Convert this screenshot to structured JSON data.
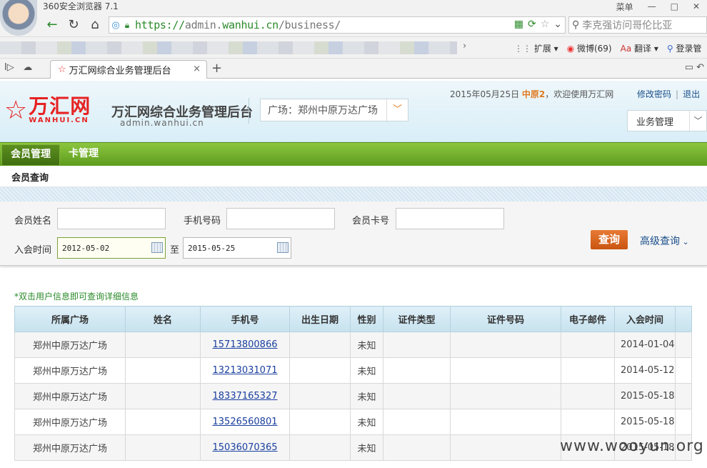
{
  "browser": {
    "name": "360安全浏览器 7.1",
    "window_controls": [
      "菜单",
      "—",
      "□",
      "✕"
    ],
    "url_scheme": "https://",
    "url_host_prefix": "admin.",
    "url_host_main": "wanhui.cn",
    "url_path": "/business/",
    "search_text": "李克强访问哥伦比亚",
    "favbar": {
      "extensions": "扩展",
      "weibo": "微博(69)",
      "translate": "翻译",
      "login": "登录管"
    },
    "tab_title": "万汇网综合业务管理后台"
  },
  "header": {
    "logo_cn": "万汇网",
    "logo_en": "WANHUI.CN",
    "title": "万汇网综合业务管理后台",
    "domain": "admin.wanhui.cn",
    "plaza_label": "广场：郑州中原万达广场",
    "date": "2015年05月25日",
    "username": "中原2",
    "welcome": "，欢迎使用万汇网",
    "change_password": "修改密码",
    "logout": "退出",
    "module_select": "业务管理"
  },
  "nav": {
    "items": [
      "会员管理",
      "卡管理"
    ],
    "sub_title": "会员查询"
  },
  "search": {
    "member_name_label": "会员姓名",
    "phone_label": "手机号码",
    "card_label": "会员卡号",
    "join_time_label": "入会时间",
    "date_from": "2012-05-02",
    "date_sep": "至",
    "date_to": "2015-05-25",
    "query_button": "查询",
    "advanced_query": "高级查询"
  },
  "results": {
    "hint": "*双击用户信息即可查询详细信息",
    "columns": [
      "所属广场",
      "姓名",
      "手机号",
      "出生日期",
      "性别",
      "证件类型",
      "证件号码",
      "电子邮件",
      "入会时间"
    ],
    "rows": [
      {
        "plaza": "郑州中原万达广场",
        "name": "",
        "phone": "15713800866",
        "birth": "",
        "gender": "未知",
        "id_type": "",
        "id_no": "",
        "email": "",
        "join": "2014-01-04"
      },
      {
        "plaza": "郑州中原万达广场",
        "name": "",
        "phone": "13213031071",
        "birth": "",
        "gender": "未知",
        "id_type": "",
        "id_no": "",
        "email": "",
        "join": "2014-05-12"
      },
      {
        "plaza": "郑州中原万达广场",
        "name": "",
        "phone": "18337165327",
        "birth": "",
        "gender": "未知",
        "id_type": "",
        "id_no": "",
        "email": "",
        "join": "2015-05-18"
      },
      {
        "plaza": "郑州中原万达广场",
        "name": "",
        "phone": "13526560801",
        "birth": "",
        "gender": "未知",
        "id_type": "",
        "id_no": "",
        "email": "",
        "join": "2015-05-18"
      },
      {
        "plaza": "郑州中原万达广场",
        "name": "",
        "phone": "15036070365",
        "birth": "",
        "gender": "未知",
        "id_type": "",
        "id_no": "",
        "email": "",
        "join": "2015-05-18"
      }
    ]
  },
  "watermark": "www.wooyun.org"
}
